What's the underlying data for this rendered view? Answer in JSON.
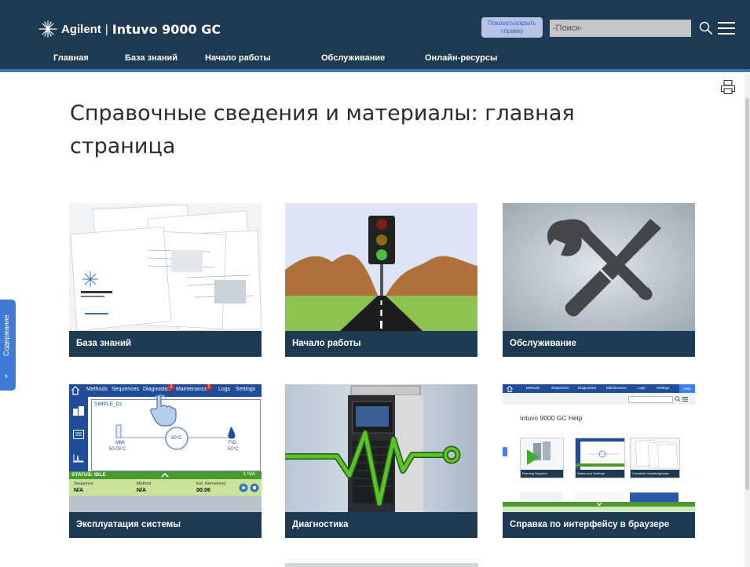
{
  "header": {
    "brand_name": "Agilent",
    "brand_separator": "|",
    "product_name": "Intuvo 9000 GC",
    "help_toggle_label": "Показать\\скрыть справку",
    "search_placeholder": "-Поиск-",
    "nav": [
      {
        "label": "Главная"
      },
      {
        "label": "База знаний"
      },
      {
        "label": "Начало работы"
      },
      {
        "label": "Обслуживание"
      },
      {
        "label": "Онлайн-ресурсы"
      }
    ]
  },
  "toc_tab": {
    "label": "Содержание",
    "chevron": "›"
  },
  "page_title": "Справочные сведения и материалы: главная страница",
  "cards": [
    {
      "label": "База знаний",
      "icon": "manuals-image"
    },
    {
      "label": "Начало работы",
      "icon": "traffic-light-road-image"
    },
    {
      "label": "Обслуживание",
      "icon": "wrench-screwdriver-image"
    },
    {
      "label": "Эксплуатация системы",
      "icon": "instrument-screen-image"
    },
    {
      "label": "Диагностика",
      "icon": "instrument-heartbeat-image"
    },
    {
      "label": "Справка по интерфейсу в браузере",
      "icon": "browser-help-image"
    }
  ],
  "screen_mock": {
    "tabs": [
      "Methods",
      "Sequences",
      "Diagnostics",
      "Maintenance",
      "Logs",
      "Settings"
    ],
    "diag_badge": "2",
    "maint_badge": "2",
    "method_name": "SIMPLE_D1",
    "inlet_name": "MMI",
    "inlet_temp": "50.05°C",
    "oven_temp": "50°C",
    "detector_name": "FID",
    "detector_temp": "50°C",
    "status": "STATUS: IDLE",
    "status_right": "1 N/A",
    "sequence_label": "Sequence",
    "sequence_value": "N/A",
    "method_label": "Method",
    "method_value": "N/A",
    "remaining_label": "Est. Remaining",
    "remaining_value": "00:06"
  },
  "help_mock": {
    "tabs": [
      "Methods",
      "Sequences",
      "Diagnostics",
      "Maintenance",
      "Logs",
      "Settings",
      "Help"
    ],
    "title": "Intuvo 9000 GC Help",
    "thumb_labels": [
      "Running Samples",
      "Status and Settings",
      "Complete Knowledgebase"
    ]
  },
  "colors": {
    "header_bg": "#1d3a52",
    "accent": "#3d73b9",
    "card_caption_bg": "#1d3a52",
    "screen_green": "#9ac43a",
    "heartbeat_green": "#5dc12a"
  }
}
